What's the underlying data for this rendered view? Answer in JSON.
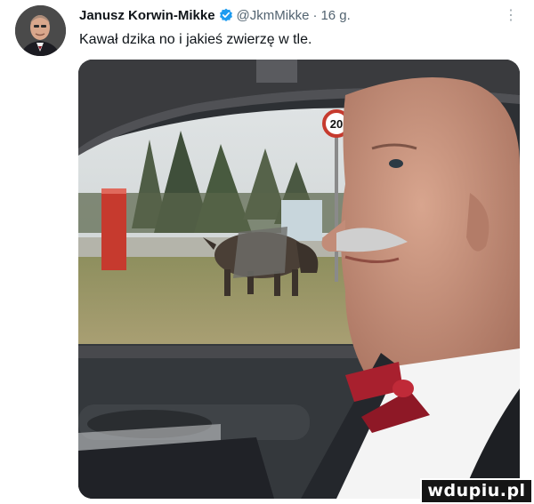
{
  "post": {
    "author_name": "Janusz Korwin-Mikke",
    "handle": "@JkmMikke",
    "separator": "·",
    "time": "16 g.",
    "text": "Kawał dzika no i jakieś zwierzę w tle.",
    "more_menu": "⋮",
    "verified_color": "#1d9bf0"
  },
  "media": {
    "road_sign_text": "20"
  },
  "watermark": {
    "text": "wdupiu.pl"
  }
}
